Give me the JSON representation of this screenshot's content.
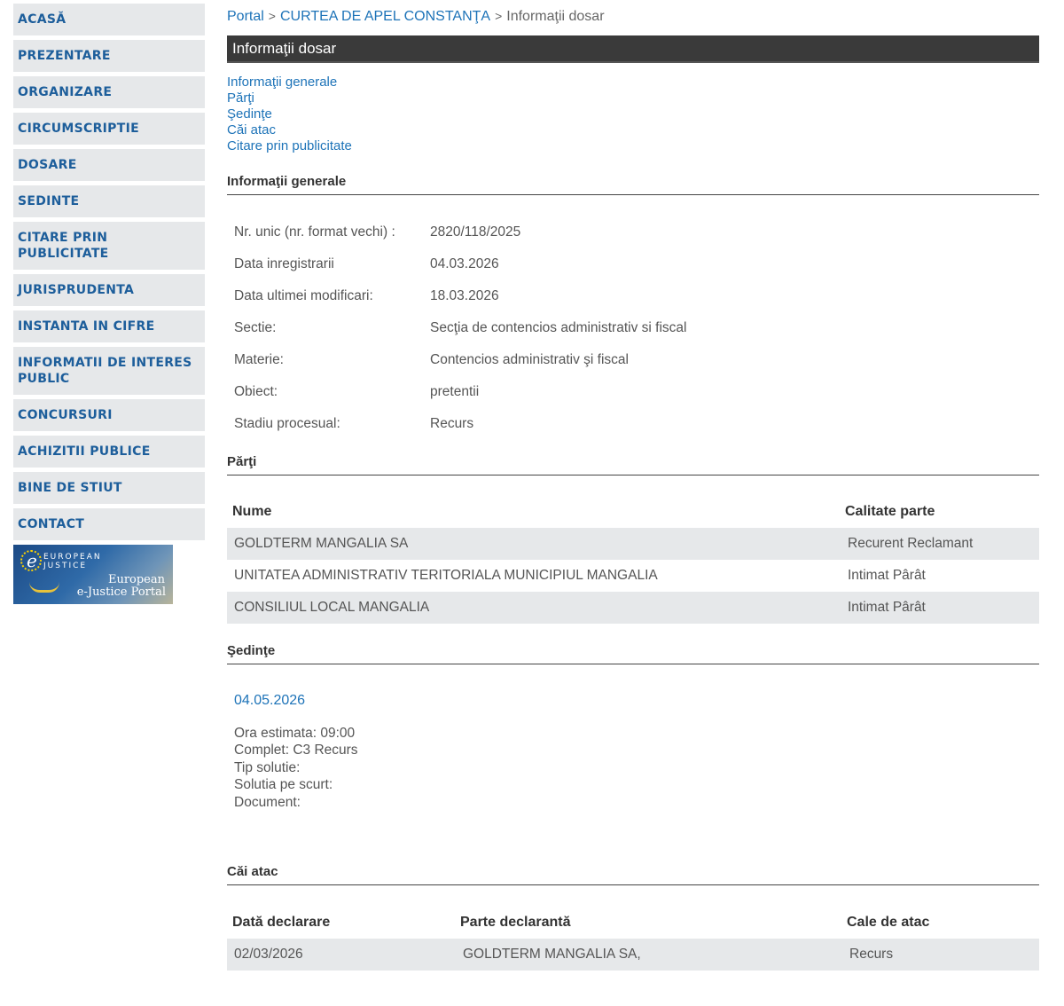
{
  "sidebar": {
    "items": [
      "ACASĂ",
      "PREZENTARE",
      "ORGANIZARE",
      "CIRCUMSCRIPTIE",
      "DOSARE",
      "SEDINTE",
      "CITARE PRIN PUBLICITATE",
      "JURISPRUDENTA",
      "INSTANTA IN CIFRE",
      "INFORMATII DE INTERES PUBLIC",
      "CONCURSURI",
      "ACHIZITII PUBLICE",
      "BINE DE STIUT",
      "CONTACT"
    ],
    "banner": {
      "small_text_1": "EUROPEAN",
      "small_text_2": "JUSTICE",
      "title_line_1": "European",
      "title_line_2": "e-Justice Portal"
    }
  },
  "breadcrumb": {
    "home": "Portal",
    "sep": ">",
    "court": "CURTEA DE APEL CONSTANŢA",
    "current": "Informaţii dosar"
  },
  "page_title": "Informaţii dosar",
  "jump_links": [
    "Informaţii generale",
    "Părţi",
    "Şedinţe",
    "Căi atac",
    "Citare prin publicitate"
  ],
  "general": {
    "heading": "Informaţii generale",
    "rows": [
      {
        "label": "Nr. unic (nr. format vechi) :",
        "value": "2820/118/2025"
      },
      {
        "label": "Data inregistrarii",
        "value": "04.03.2026"
      },
      {
        "label": "Data ultimei modificari:",
        "value": "18.03.2026"
      },
      {
        "label": "Sectie:",
        "value": "Secţia de contencios administrativ si fiscal"
      },
      {
        "label": "Materie:",
        "value": "Contencios administrativ şi fiscal"
      },
      {
        "label": "Obiect:",
        "value": "pretentii"
      },
      {
        "label": "Stadiu procesual:",
        "value": "Recurs"
      }
    ]
  },
  "parties": {
    "heading": "Părţi",
    "columns": [
      "Nume",
      "Calitate parte"
    ],
    "rows": [
      {
        "name": "GOLDTERM MANGALIA SA",
        "role": "Recurent Reclamant"
      },
      {
        "name": "UNITATEA ADMINISTRATIV TERITORIALA MUNICIPIUL MANGALIA",
        "role": "Intimat Pârât"
      },
      {
        "name": "CONSILIUL LOCAL MANGALIA",
        "role": "Intimat Pârât"
      }
    ]
  },
  "sessions": {
    "heading": "Şedinţe",
    "date": "04.05.2026",
    "details": [
      "Ora estimata: 09:00",
      "Complet: C3 Recurs",
      "Tip solutie:",
      "Solutia pe scurt:",
      "Document:"
    ]
  },
  "appeals": {
    "heading": "Căi atac",
    "columns": [
      "Dată declarare",
      "Parte declarantă",
      "Cale de atac"
    ],
    "rows": [
      {
        "date": "02/03/2026",
        "party": "GOLDTERM MANGALIA SA,",
        "type": "Recurs"
      }
    ]
  }
}
